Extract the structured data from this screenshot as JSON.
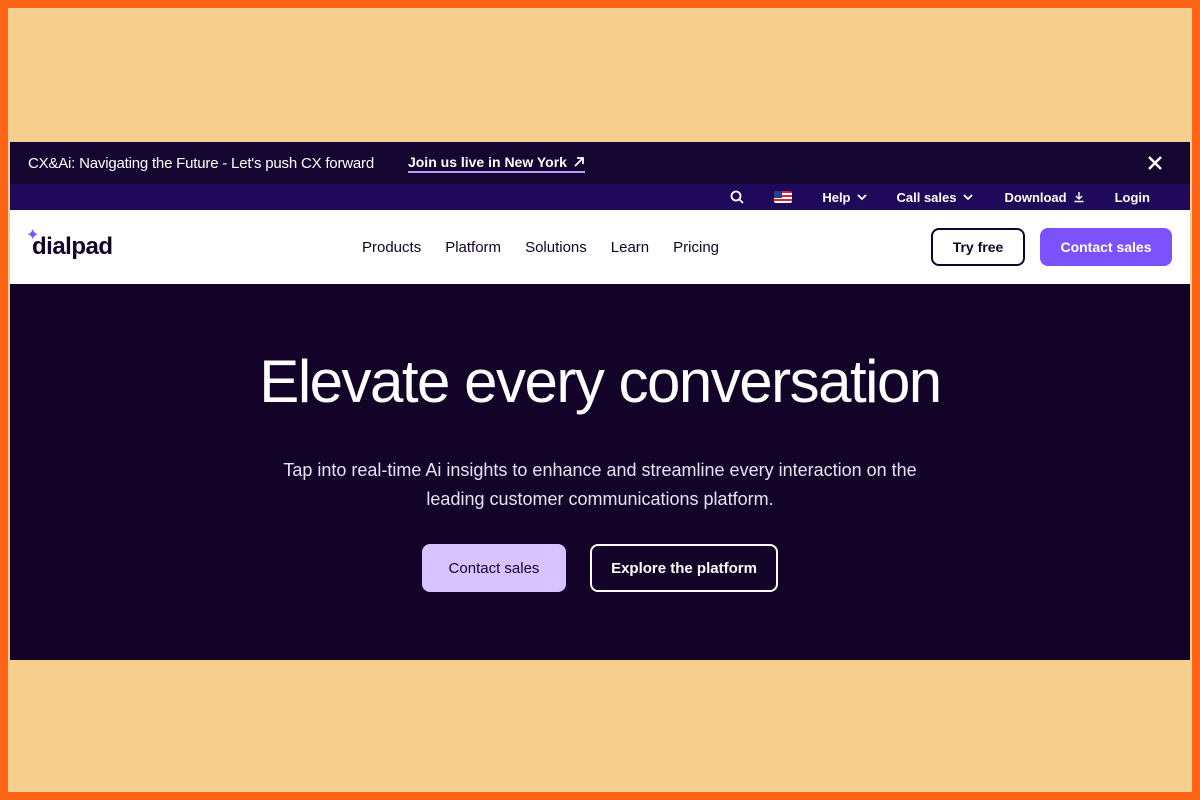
{
  "announcement": {
    "text": "CX&Ai: Navigating the Future - Let's push CX forward",
    "link_label": "Join us live in New York",
    "link_icon": "arrow-up-right-icon",
    "close_icon": "close-icon"
  },
  "utility": {
    "search_icon": "search-icon",
    "flag_icon": "us-flag-icon",
    "help_label": "Help",
    "call_sales_label": "Call sales",
    "download_label": "Download",
    "login_label": "Login"
  },
  "nav": {
    "logo_text": "dialpad",
    "links": [
      "Products",
      "Platform",
      "Solutions",
      "Learn",
      "Pricing"
    ],
    "try_free_label": "Try free",
    "contact_sales_label": "Contact sales"
  },
  "hero": {
    "title": "Elevate every conversation",
    "subtitle": "Tap into real-time Ai insights to enhance and streamline every interaction on the leading customer communications platform.",
    "primary_label": "Contact sales",
    "secondary_label": "Explore the platform"
  },
  "colors": {
    "frame_outer": "#ff6316",
    "frame_inner": "#f6ce8e",
    "hero_background": "#130329",
    "utility_bar": "#20085a",
    "accent_purple": "#7c52ff",
    "accent_lilac": "#d6c3ff"
  }
}
